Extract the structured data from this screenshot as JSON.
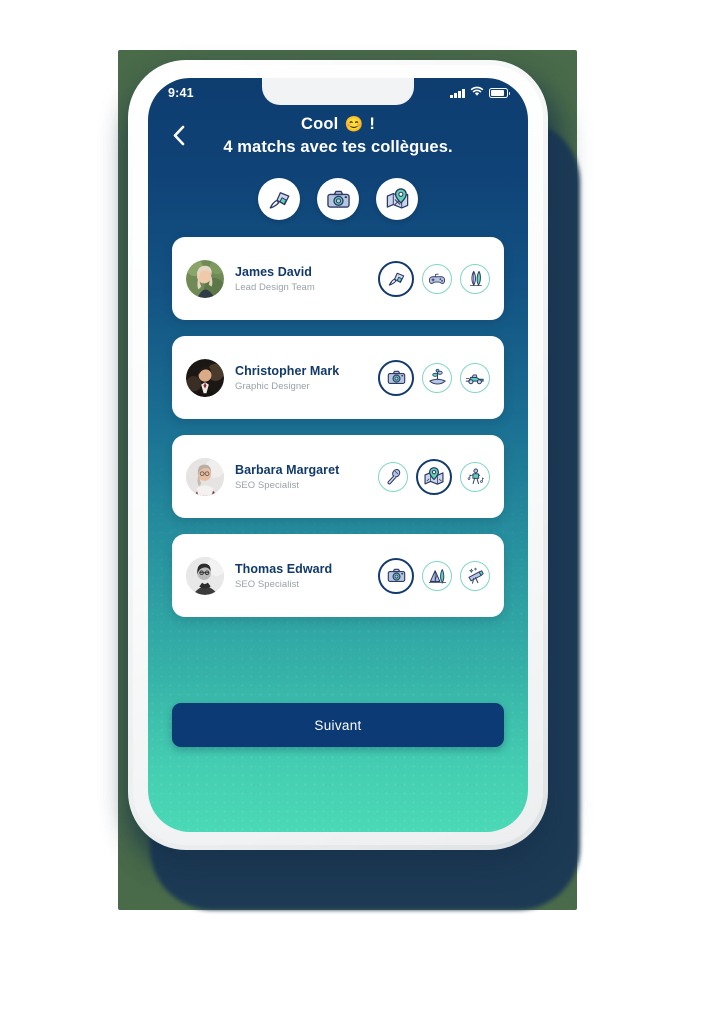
{
  "status_bar": {
    "time": "9:41",
    "signal_icon": "cellular-bars-icon",
    "wifi_icon": "wifi-icon",
    "battery_icon": "battery-icon"
  },
  "header": {
    "back_icon": "chevron-left-icon",
    "title_line1_text": "Cool",
    "title_emoji": "😊",
    "title_line1_suffix": "!",
    "title_line2": "4 matchs avec tes collègues.",
    "category_icons": [
      {
        "name": "paint-spray-icon",
        "label": "Art"
      },
      {
        "name": "camera-icon",
        "label": "Photo"
      },
      {
        "name": "map-pin-icon",
        "label": "Voyage"
      }
    ]
  },
  "matches": [
    {
      "name": "James David",
      "role": "Lead Design Team",
      "avatar_name": "avatar-james-david",
      "interests": [
        {
          "icon": "paint-spray-icon",
          "active": true
        },
        {
          "icon": "gamepad-icon",
          "active": false
        },
        {
          "icon": "surfboard-icon",
          "active": false
        }
      ]
    },
    {
      "name": "Christopher Mark",
      "role": "Graphic Designer",
      "avatar_name": "avatar-christopher-mark",
      "interests": [
        {
          "icon": "camera-icon",
          "active": true
        },
        {
          "icon": "plant-in-hand-icon",
          "active": false
        },
        {
          "icon": "race-car-icon",
          "active": false
        }
      ]
    },
    {
      "name": "Barbara Margaret",
      "role": "SEO Specialist",
      "avatar_name": "avatar-barbara-margaret",
      "interests": [
        {
          "icon": "microphone-icon",
          "active": false
        },
        {
          "icon": "map-pin-icon",
          "active": true
        },
        {
          "icon": "dancing-person-icon",
          "active": false
        }
      ]
    },
    {
      "name": "Thomas Edward",
      "role": "SEO Specialist",
      "avatar_name": "avatar-thomas-edward",
      "interests": [
        {
          "icon": "camera-icon",
          "active": true
        },
        {
          "icon": "camping-tent-icon",
          "active": false
        },
        {
          "icon": "telescope-icon",
          "active": false
        }
      ]
    }
  ],
  "footer": {
    "next_button_label": "Suivant"
  },
  "colors": {
    "screen_top": "#0e3d70",
    "screen_bottom": "#4ad9b6",
    "accent_navy": "#0b3a74",
    "accent_teal": "#7fd8c4",
    "name_text": "#113a6b",
    "role_text": "#9aa2a8",
    "backdrop_green": "#4a6b4a",
    "shadow_navy": "#1d3a55"
  }
}
